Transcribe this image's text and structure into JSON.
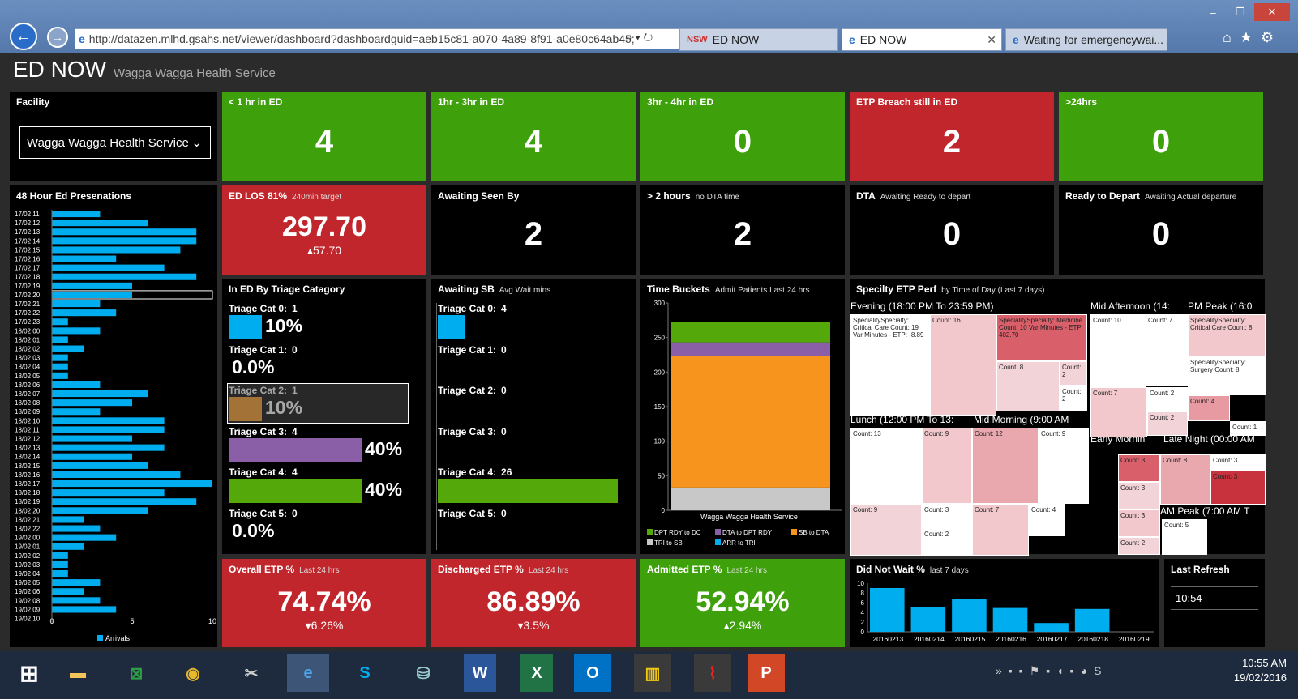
{
  "browser": {
    "url": "http://datazen.mlhd.gsahs.net/viewer/dashboard?dashboardguid=aeb15c81-a070-4a89-8f91-a0e80c64ab45;",
    "tabs": [
      "ED NOW",
      "ED NOW",
      "Waiting for emergencywai..."
    ]
  },
  "header": {
    "title": "ED NOW",
    "subtitle": "Wagga Wagga Health Service"
  },
  "facility": {
    "label": "Facility",
    "value": "Wagga Wagga Health Service"
  },
  "kpis": [
    {
      "label": "< 1 hr in ED",
      "value": "4",
      "color": "#3ea10b"
    },
    {
      "label": "1hr - 3hr in ED",
      "value": "4",
      "color": "#3ea10b"
    },
    {
      "label": "3hr - 4hr in ED",
      "value": "0",
      "color": "#3ea10b"
    },
    {
      "label": "ETP Breach still in ED",
      "value": "2",
      "color": "#c0262b"
    },
    {
      "label": ">24hrs",
      "value": "0",
      "color": "#3ea10b"
    }
  ],
  "row2": [
    {
      "label": "ED LOS 81%",
      "note": "240min target",
      "value": "297.70",
      "delta": "▴57.70"
    },
    {
      "label": "Awaiting Seen By",
      "note": "",
      "value": "2"
    },
    {
      "label": "> 2 hours",
      "note": "no DTA time",
      "value": "2"
    },
    {
      "label": "DTA",
      "note": "Awaiting Ready to depart",
      "value": "0"
    },
    {
      "label": "Ready to Depart",
      "note": "Awaiting Actual departure",
      "value": "0"
    }
  ],
  "presentations": {
    "title": "48 Hour Ed Presenations",
    "legend": "Arrivals",
    "ticks": [
      "0",
      "5",
      "10"
    ],
    "labels": [
      "17/02 11",
      "17/02 12",
      "17/02 13",
      "17/02 14",
      "17/02 15",
      "17/02 16",
      "17/02 17",
      "17/02 18",
      "17/02 19",
      "17/02 20",
      "17/02 21",
      "17/02 22",
      "17/02 23",
      "18/02 00",
      "18/02 01",
      "18/02 02",
      "18/02 03",
      "18/02 04",
      "18/02 05",
      "18/02 06",
      "18/02 07",
      "18/02 08",
      "18/02 09",
      "18/02 10",
      "18/02 11",
      "18/02 12",
      "18/02 13",
      "18/02 14",
      "18/02 15",
      "18/02 16",
      "18/02 17",
      "18/02 18",
      "18/02 19",
      "18/02 20",
      "18/02 21",
      "18/02 22",
      "19/02 00",
      "19/02 01",
      "19/02 02",
      "19/02 03",
      "19/02 04",
      "19/02 05",
      "19/02 06",
      "19/02 08",
      "19/02 09",
      "19/02 10"
    ],
    "values": [
      3,
      6,
      9,
      9,
      8,
      4,
      7,
      9,
      5,
      5,
      3,
      4,
      1,
      3,
      1,
      2,
      1,
      1,
      1,
      3,
      6,
      5,
      3,
      7,
      7,
      5,
      7,
      5,
      6,
      8,
      10,
      7,
      9,
      6,
      2,
      3,
      4,
      2,
      1,
      1,
      1,
      3,
      2,
      3,
      4,
      0
    ]
  },
  "triage": {
    "title": "In ED By Triage Catagory",
    "rows": [
      {
        "label": "Triage Cat 0:",
        "count": "1",
        "pct": "10%",
        "frac": 0.1,
        "color": "#00aeef"
      },
      {
        "label": "Triage Cat 1:",
        "count": "0",
        "pct": "0.0%",
        "frac": 0,
        "color": "#888"
      },
      {
        "label": "Triage Cat 2:",
        "count": "1",
        "pct": "10%",
        "frac": 0.1,
        "color": "#f7941d"
      },
      {
        "label": "Triage Cat 3:",
        "count": "4",
        "pct": "40%",
        "frac": 0.4,
        "color": "#8b5ea8"
      },
      {
        "label": "Triage Cat 4:",
        "count": "4",
        "pct": "40%",
        "frac": 0.4,
        "color": "#55a80a"
      },
      {
        "label": "Triage Cat 5:",
        "count": "0",
        "pct": "0.0%",
        "frac": 0,
        "color": "#888"
      }
    ]
  },
  "awaiting_sb": {
    "title": "Awaiting SB",
    "note": "Avg Wait mins",
    "rows": [
      {
        "label": "Triage Cat 0:",
        "count": "4",
        "frac": 0.15,
        "color": "#00aeef"
      },
      {
        "label": "Triage Cat 1:",
        "count": "0",
        "frac": 0,
        "color": "#888"
      },
      {
        "label": "Triage Cat 2:",
        "count": "0",
        "frac": 0,
        "color": "#888"
      },
      {
        "label": "Triage Cat 3:",
        "count": "0",
        "frac": 0,
        "color": "#888"
      },
      {
        "label": "Triage Cat 4:",
        "count": "26",
        "frac": 1,
        "color": "#55a80a"
      },
      {
        "label": "Triage Cat 5:",
        "count": "0",
        "frac": 0,
        "color": "#888"
      }
    ]
  },
  "chart_data": {
    "type": "bar",
    "title": "Time Buckets",
    "subtitle": "Admit Patients Last 24 hrs",
    "categories": [
      "Wagga Wagga Health Service"
    ],
    "ylim": [
      0,
      300
    ],
    "yticks": [
      "0",
      "50",
      "100",
      "150",
      "200",
      "250",
      "300"
    ],
    "series": [
      {
        "name": "TRI to SB",
        "values": [
          33
        ],
        "color": "#c8c8c8"
      },
      {
        "name": "SB to DTA",
        "values": [
          190
        ],
        "color": "#f7941d"
      },
      {
        "name": "DTA to DPT RDY",
        "values": [
          20
        ],
        "color": "#8b5ea8"
      },
      {
        "name": "DPT RDY to DC",
        "values": [
          30
        ],
        "color": "#55a80a"
      },
      {
        "name": "ARR to TRI",
        "values": [
          0
        ],
        "color": "#00aeef"
      }
    ]
  },
  "specialty": {
    "title": "Specilty ETP Perf",
    "note": "by Time of Day (Last 7 days)",
    "groups": [
      "Evening (18:00 PM To 23:59 PM)",
      "Mid Afternoon (14:",
      "PM Peak (16:0",
      "Lunch (12:00 PM To 13:",
      "Mid Morning (9:00 AM",
      "Early Mornin",
      "Late Night (00:00 AM",
      "AM Peak (7:00 AM T"
    ],
    "cells": [
      "SpecialitySpecialty: Critical Care Count: 19 Var Minutes - ETP: -8.89",
      "Count: 16",
      "SpecialitySpecialty: Medicine Count: 10 Var Minutes - ETP: 402.70",
      "Count: 8",
      "Count: 2",
      "Count: 2",
      "Count: 10",
      "Count: 7",
      "SpecialitySpecialty: Critical Care Count: 8",
      "SpecialitySpecialty: Surgery Count: 8",
      "Count: 7",
      "Count: 2",
      "Count: 2",
      "Count: 4",
      "Count: 1",
      "Count: 13",
      "Count: 9",
      "Count: 12",
      "Count: 9",
      "Count: 9",
      "Count: 3",
      "Count: 2",
      "Count: 7",
      "Count: 4",
      "Count: 3",
      "Count: 8",
      "Count: 3",
      "Count: 3",
      "Count: 3",
      "Count: 3",
      "Count: 2",
      "Count: 5"
    ]
  },
  "etp": [
    {
      "label": "Overall ETP %",
      "note": "Last 24 hrs",
      "value": "74.74%",
      "delta": "▾6.26%",
      "color": "#c0262b"
    },
    {
      "label": "Discharged ETP %",
      "note": "Last 24 hrs",
      "value": "86.89%",
      "delta": "▾3.5%",
      "color": "#c0262b"
    },
    {
      "label": "Admitted ETP %",
      "note": "Last 24 hrs",
      "value": "52.94%",
      "delta": "▴2.94%",
      "color": "#3ea10b"
    }
  ],
  "dnw": {
    "title": "Did Not Wait %",
    "note": "last 7 days",
    "dates": [
      "20160213",
      "20160214",
      "20160215",
      "20160216",
      "20160217",
      "20160218",
      "20160219"
    ],
    "values": [
      9,
      5,
      6.8,
      4.9,
      1.8,
      4.7,
      0
    ],
    "yticks": [
      "0",
      "2",
      "4",
      "6",
      "8",
      "10"
    ]
  },
  "refresh": {
    "title": "Last Refresh",
    "value": "10:54"
  },
  "taskbar": {
    "time": "10:55 AM",
    "date": "19/02/2016"
  }
}
